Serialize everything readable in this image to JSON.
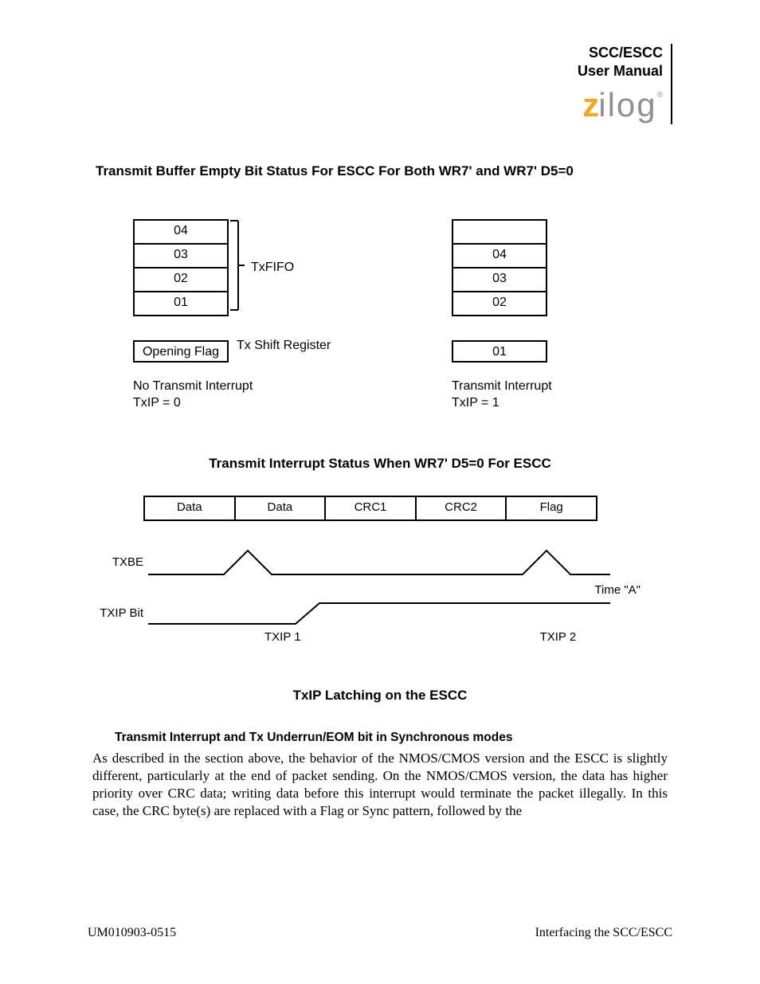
{
  "header": {
    "title_line1": "SCC/ESCC",
    "title_line2": "User Manual",
    "logo_z": "z",
    "logo_rest": "ilog",
    "logo_reg": "®"
  },
  "section_heading": "Transmit Buffer Empty Bit Status For ESCC For Both WR7' and WR7' D5=0",
  "fifo": {
    "left_stack": [
      "04",
      "03",
      "02",
      "01"
    ],
    "bracket_label": "TxFIFO",
    "left_shift": "Opening Flag",
    "shift_label": "Tx Shift Register",
    "left_caption_line1": "No Transmit Interrupt",
    "left_caption_line2": "TxIP = 0",
    "right_stack": [
      "",
      "04",
      "03",
      "02"
    ],
    "right_shift": "01",
    "right_caption_line1": "Transmit Interrupt",
    "right_caption_line2": "TxIP = 1"
  },
  "fig1_caption": "Transmit Interrupt Status When WR7' D5=0 For ESCC",
  "timing": {
    "bytes": [
      "Data",
      "Data",
      "CRC1",
      "CRC2",
      "Flag"
    ],
    "row1_label": "TXBE",
    "row2_label": "TXIP Bit",
    "time_a": "Time \"A\"",
    "annot1": "TXIP 1",
    "annot2": "TXIP 2"
  },
  "fig2_caption": "TxIP Latching on the ESCC",
  "sub_heading": "Transmit Interrupt and Tx Underrun/EOM bit in Synchronous modes",
  "body": "As described in the section above, the behavior of the NMOS/CMOS version and the ESCC is slightly different, particularly at the end of packet sending. On the NMOS/CMOS version, the data has higher priority over CRC data; writing data before this interrupt would terminate the packet illegally. In this case, the CRC byte(s) are replaced with a Flag or Sync pattern, followed by the",
  "footer": {
    "left": "UM010903-0515",
    "right": "Interfacing the SCC/ESCC"
  }
}
